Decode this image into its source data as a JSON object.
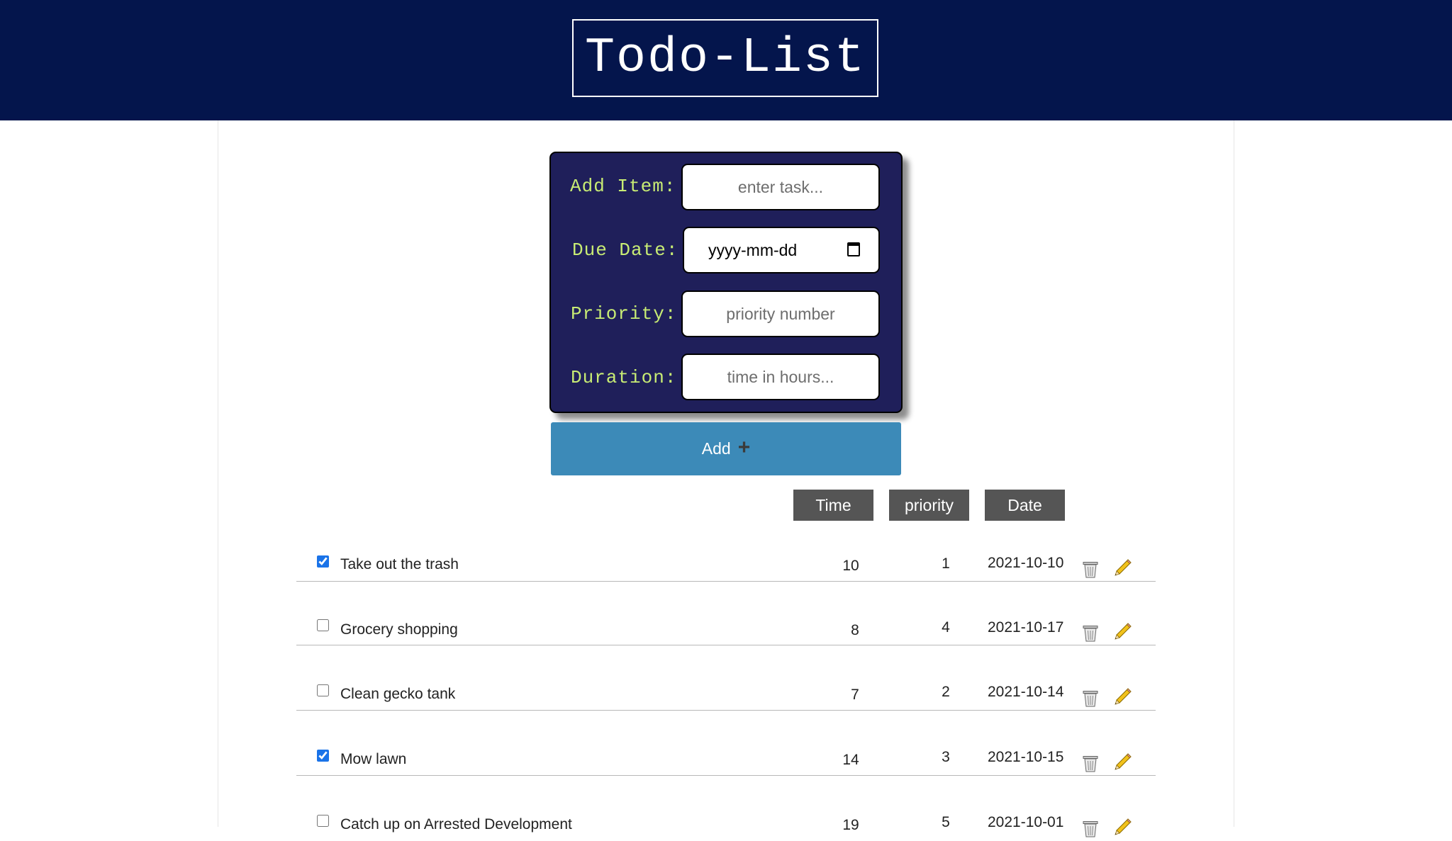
{
  "header": {
    "title": "Todo-List"
  },
  "form": {
    "add_item_label": "Add Item:",
    "add_item_placeholder": "enter task...",
    "due_date_label": "Due Date:",
    "due_date_placeholder": "yyyy-mm-dd",
    "priority_label": "Priority:",
    "priority_placeholder": "priority number",
    "duration_label": "Duration:",
    "duration_placeholder": "time in hours...",
    "add_button_label": "Add",
    "add_button_icon": "+"
  },
  "sort_buttons": {
    "time": "Time",
    "priority": "priority",
    "date": "Date"
  },
  "colors": {
    "header_bg": "#04154c",
    "panel_bg": "#1f1f5a",
    "label_color": "#c8ec74",
    "add_button_bg": "#3c8ab8",
    "sort_button_bg": "#555555"
  },
  "tasks": [
    {
      "name": "Take out the trash",
      "checked": true,
      "time": "10",
      "priority": "1",
      "date": "2021-10-10"
    },
    {
      "name": "Grocery shopping",
      "checked": false,
      "time": "8",
      "priority": "4",
      "date": "2021-10-17"
    },
    {
      "name": "Clean gecko tank",
      "checked": false,
      "time": "7",
      "priority": "2",
      "date": "2021-10-14"
    },
    {
      "name": "Mow lawn",
      "checked": true,
      "time": "14",
      "priority": "3",
      "date": "2021-10-15"
    },
    {
      "name": "Catch up on Arrested Development",
      "checked": false,
      "time": "19",
      "priority": "5",
      "date": "2021-10-01"
    }
  ]
}
